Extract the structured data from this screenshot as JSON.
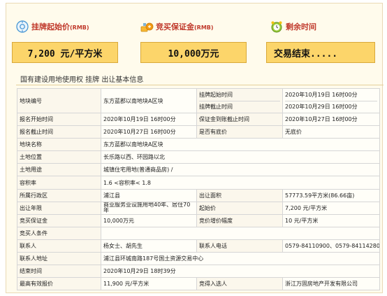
{
  "header": {
    "start_price": {
      "label": "挂牌起始价",
      "unit": "(RMB)",
      "value": "7,200 元/平方米"
    },
    "deposit": {
      "label": "竞买保证金",
      "unit": "(RMB)",
      "value": "10,000万元"
    },
    "remaining": {
      "label": "剩余时间",
      "value": "交易结束....."
    }
  },
  "section_title": "国有建设用地使用权 挂牌 出让基本信息",
  "rows": [
    {
      "k1": "地块编号",
      "v1": "东方蓝郡以南地块A区块",
      "k2a": "挂牌起始时间",
      "k2b": "挂牌截止时间",
      "v2a": "2020年10月19日 16时00分",
      "v2b": "2020年10月29日 16时00分"
    },
    {
      "k1": "报名开始时间",
      "v1": "2020年10月19日 16时00分",
      "k2": "保证金到账截止时间",
      "v2": "2020年10月27日 16时00分"
    },
    {
      "k1": "报名截止时间",
      "v1": "2020年10月27日 16时00分",
      "k2": "是否有底价",
      "v2": "无底价"
    },
    {
      "k1": "地块名称",
      "v1": "东方蓝郡以南地块A区块"
    },
    {
      "k1": "土地位置",
      "v1": "长乐路以西、环园路以北"
    },
    {
      "k1": "土地用途",
      "v1": "城镇住宅用地(普通商品房) /"
    },
    {
      "k1": "容积率",
      "v1": "1.6 <容积率< 1.8"
    },
    {
      "k1": "所属行政区",
      "v1": "浦江县",
      "k2": "出让面积",
      "v2": "57773.59平方米(86.66亩)"
    },
    {
      "k1": "出让年限",
      "v1a": "商业服务业设施用地40年、居住70",
      "v1b": "年",
      "k2": "起始价",
      "v2": "7,200 元/平方米"
    },
    {
      "k1": "竞买保证金",
      "v1": "10,000万元",
      "k2": "竞价增价幅度",
      "v2": "10 元/平方米"
    },
    {
      "k1": "竞买人条件",
      "v1": ""
    },
    {
      "k1": "联系人",
      "v1": "杨女士、胡先生",
      "k2": "联系人电话",
      "v2": "0579-84110900、0579-84114280"
    },
    {
      "k1": "联系人地址",
      "v1": "浦江县环城南路187号国土资源交易中心"
    },
    {
      "k1": "结束时间",
      "v1": "2020年10月29日 18时39分"
    },
    {
      "k1": "最高有效报价",
      "v1": "11,900 元/平方米",
      "k2": "竞得入选人",
      "v2": "",
      "v3": "浙江万固房地产开发有限公司"
    }
  ]
}
